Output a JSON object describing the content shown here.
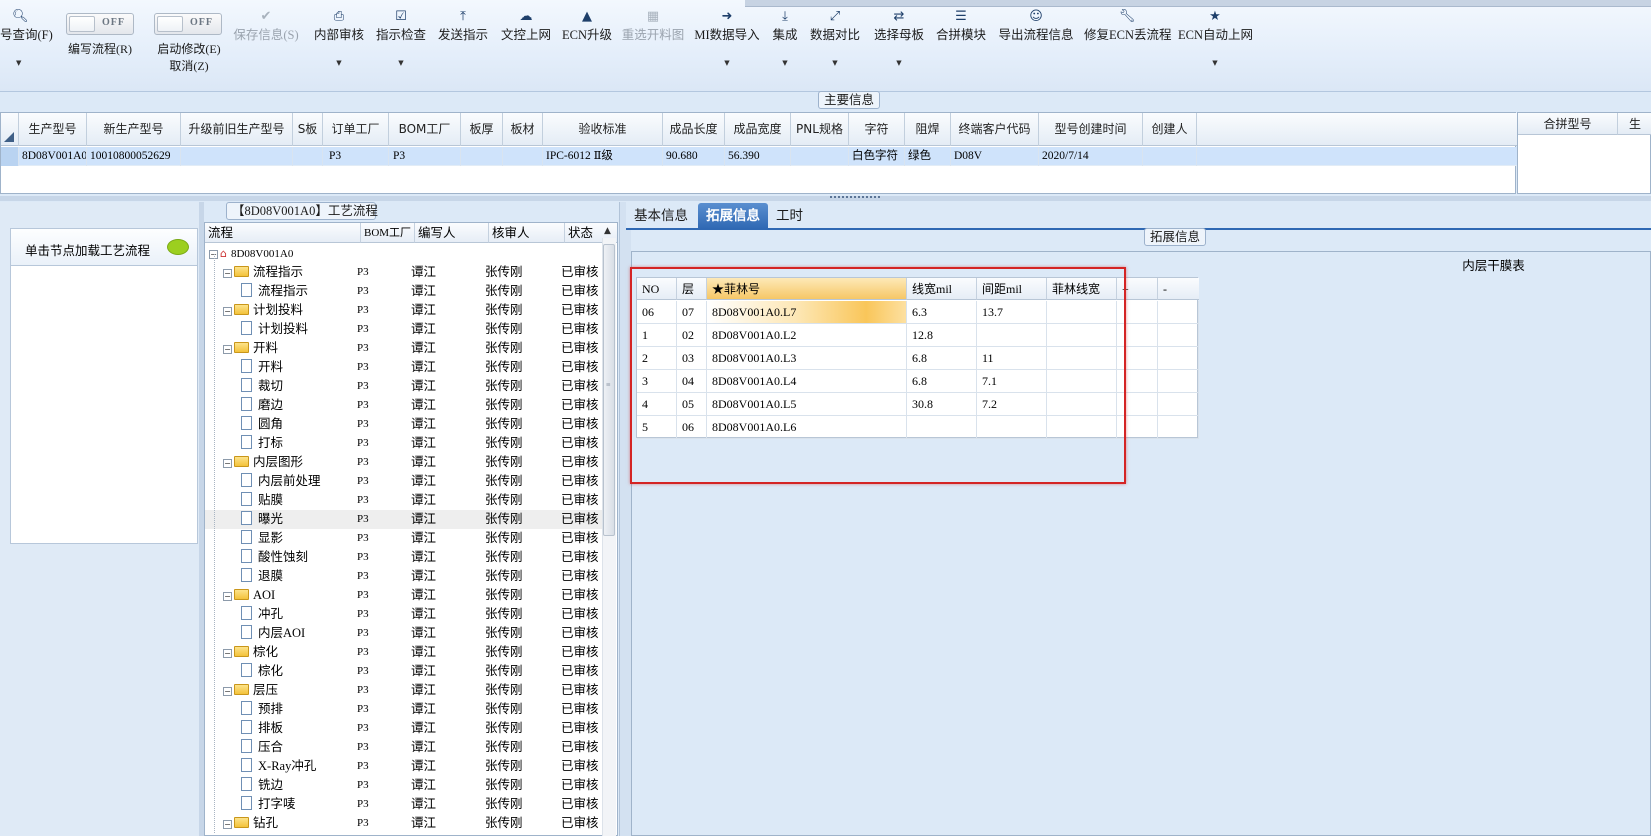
{
  "toolbar": {
    "query_label": "号查询(F)",
    "edit_flow": {
      "toggle": "OFF",
      "label": "编写流程(R)"
    },
    "start_modify": {
      "toggle": "OFF",
      "label": "启动修改(E)",
      "sub_label": "取消(Z)"
    },
    "buttons": [
      {
        "label": "保存信息(S)",
        "icon": "check-icon",
        "disabled": true
      },
      {
        "label": "内部审核",
        "icon": "printer-icon"
      },
      {
        "label": "指示检查",
        "icon": "checkbox-icon"
      },
      {
        "label": "发送指示",
        "icon": "upload-icon"
      },
      {
        "label": "文控上网",
        "icon": "cloud-upload-icon"
      },
      {
        "label": "ECN升级",
        "icon": "ecn-icon"
      },
      {
        "label": "重选开料图",
        "icon": "image-icon",
        "disabled": true
      },
      {
        "label": "MI数据导入",
        "icon": "import-icon"
      },
      {
        "label": "集成",
        "icon": "download-icon"
      },
      {
        "label": "数据对比",
        "icon": "compare-icon"
      },
      {
        "label": "选择母板",
        "icon": "shuffle-icon"
      },
      {
        "label": "合拼模块",
        "icon": "list-icon"
      },
      {
        "label": "导出流程信息",
        "icon": "smile-icon"
      },
      {
        "label": "修复ECN丢流程",
        "icon": "wrench-icon"
      },
      {
        "label": "ECN自动上网",
        "icon": "star-icon"
      }
    ]
  },
  "main_info": {
    "caption": "主要信息",
    "columns": [
      "生产型号",
      "新生产型号",
      "升级前旧生产型号",
      "S板",
      "订单工厂",
      "BOM工厂",
      "板厚",
      "板材",
      "验收标准",
      "成品长度",
      "成品宽度",
      "PNL规格",
      "字符",
      "阻焊",
      "终端客户代码",
      "型号创建时间",
      "创建人"
    ],
    "row": [
      "8D08V001A0",
      "10010800052629",
      "",
      "",
      "P3",
      "P3",
      "",
      "",
      "IPC-6012 Ⅱ级",
      "90.680",
      "56.390",
      "",
      "白色字符",
      "绿色",
      "D08V",
      "2020/7/14",
      ""
    ],
    "right_columns": [
      "合拼型号",
      "生"
    ]
  },
  "left_panel": {
    "load_button": "单击节点加载工艺流程"
  },
  "flow": {
    "caption": "【8D08V001A0】工艺流程",
    "columns": [
      "流程",
      "BOM工厂",
      "编写人",
      "核审人",
      "状态"
    ],
    "rows": [
      {
        "name": "8D08V001A0",
        "level": 0,
        "type": "root",
        "bom": "",
        "writer": "",
        "reviewer": "",
        "status": ""
      },
      {
        "name": "流程指示",
        "level": 1,
        "type": "folder",
        "bom": "P3",
        "writer": "谭江",
        "reviewer": "张传刚",
        "status": "已审核"
      },
      {
        "name": "流程指示",
        "level": 2,
        "type": "doc",
        "bom": "P3",
        "writer": "谭江",
        "reviewer": "张传刚",
        "status": "已审核"
      },
      {
        "name": "计划投料",
        "level": 1,
        "type": "folder",
        "bom": "P3",
        "writer": "谭江",
        "reviewer": "张传刚",
        "status": "已审核"
      },
      {
        "name": "计划投料",
        "level": 2,
        "type": "doc",
        "bom": "P3",
        "writer": "谭江",
        "reviewer": "张传刚",
        "status": "已审核"
      },
      {
        "name": "开料",
        "level": 1,
        "type": "folder",
        "bom": "P3",
        "writer": "谭江",
        "reviewer": "张传刚",
        "status": "已审核"
      },
      {
        "name": "开料",
        "level": 2,
        "type": "doc",
        "bom": "P3",
        "writer": "谭江",
        "reviewer": "张传刚",
        "status": "已审核"
      },
      {
        "name": "裁切",
        "level": 2,
        "type": "doc",
        "bom": "P3",
        "writer": "谭江",
        "reviewer": "张传刚",
        "status": "已审核"
      },
      {
        "name": "磨边",
        "level": 2,
        "type": "doc",
        "bom": "P3",
        "writer": "谭江",
        "reviewer": "张传刚",
        "status": "已审核"
      },
      {
        "name": "圆角",
        "level": 2,
        "type": "doc",
        "bom": "P3",
        "writer": "谭江",
        "reviewer": "张传刚",
        "status": "已审核"
      },
      {
        "name": "打标",
        "level": 2,
        "type": "doc",
        "bom": "P3",
        "writer": "谭江",
        "reviewer": "张传刚",
        "status": "已审核"
      },
      {
        "name": "内层图形",
        "level": 1,
        "type": "folder",
        "bom": "P3",
        "writer": "谭江",
        "reviewer": "张传刚",
        "status": "已审核"
      },
      {
        "name": "内层前处理",
        "level": 2,
        "type": "doc",
        "bom": "P3",
        "writer": "谭江",
        "reviewer": "张传刚",
        "status": "已审核"
      },
      {
        "name": "贴膜",
        "level": 2,
        "type": "doc",
        "bom": "P3",
        "writer": "谭江",
        "reviewer": "张传刚",
        "status": "已审核"
      },
      {
        "name": "曝光",
        "level": 2,
        "type": "doc",
        "bom": "P3",
        "writer": "谭江",
        "reviewer": "张传刚",
        "status": "已审核",
        "selected": true
      },
      {
        "name": "显影",
        "level": 2,
        "type": "doc",
        "bom": "P3",
        "writer": "谭江",
        "reviewer": "张传刚",
        "status": "已审核"
      },
      {
        "name": "酸性蚀刻",
        "level": 2,
        "type": "doc",
        "bom": "P3",
        "writer": "谭江",
        "reviewer": "张传刚",
        "status": "已审核"
      },
      {
        "name": "退膜",
        "level": 2,
        "type": "doc",
        "bom": "P3",
        "writer": "谭江",
        "reviewer": "张传刚",
        "status": "已审核"
      },
      {
        "name": "AOI",
        "level": 1,
        "type": "folder",
        "bom": "P3",
        "writer": "谭江",
        "reviewer": "张传刚",
        "status": "已审核"
      },
      {
        "name": "冲孔",
        "level": 2,
        "type": "doc",
        "bom": "P3",
        "writer": "谭江",
        "reviewer": "张传刚",
        "status": "已审核"
      },
      {
        "name": "内层AOI",
        "level": 2,
        "type": "doc",
        "bom": "P3",
        "writer": "谭江",
        "reviewer": "张传刚",
        "status": "已审核"
      },
      {
        "name": "棕化",
        "level": 1,
        "type": "folder",
        "bom": "P3",
        "writer": "谭江",
        "reviewer": "张传刚",
        "status": "已审核"
      },
      {
        "name": "棕化",
        "level": 2,
        "type": "doc",
        "bom": "P3",
        "writer": "谭江",
        "reviewer": "张传刚",
        "status": "已审核"
      },
      {
        "name": "层压",
        "level": 1,
        "type": "folder",
        "bom": "P3",
        "writer": "谭江",
        "reviewer": "张传刚",
        "status": "已审核"
      },
      {
        "name": "预排",
        "level": 2,
        "type": "doc",
        "bom": "P3",
        "writer": "谭江",
        "reviewer": "张传刚",
        "status": "已审核"
      },
      {
        "name": "排板",
        "level": 2,
        "type": "doc",
        "bom": "P3",
        "writer": "谭江",
        "reviewer": "张传刚",
        "status": "已审核"
      },
      {
        "name": "压合",
        "level": 2,
        "type": "doc",
        "bom": "P3",
        "writer": "谭江",
        "reviewer": "张传刚",
        "status": "已审核"
      },
      {
        "name": "X-Ray冲孔",
        "level": 2,
        "type": "doc",
        "bom": "P3",
        "writer": "谭江",
        "reviewer": "张传刚",
        "status": "已审核"
      },
      {
        "name": "铣边",
        "level": 2,
        "type": "doc",
        "bom": "P3",
        "writer": "谭江",
        "reviewer": "张传刚",
        "status": "已审核"
      },
      {
        "name": "打字唛",
        "level": 2,
        "type": "doc",
        "bom": "P3",
        "writer": "谭江",
        "reviewer": "张传刚",
        "status": "已审核"
      },
      {
        "name": "钻孔",
        "level": 1,
        "type": "folder",
        "bom": "P3",
        "writer": "谭江",
        "reviewer": "张传刚",
        "status": "已审核"
      }
    ]
  },
  "tabs": [
    {
      "label": "基本信息",
      "active": false
    },
    {
      "label": "拓展信息",
      "active": true
    },
    {
      "label": "工时",
      "active": false
    }
  ],
  "extension": {
    "caption": "拓展信息",
    "table_title": "内层干膜表",
    "columns": [
      "NO",
      "层",
      "★菲林号",
      "线宽mil",
      "间距mil",
      "菲林线宽",
      "+",
      "-"
    ],
    "rows": [
      [
        "06",
        "07",
        "8D08V001A0.L7",
        "6.3",
        "13.7",
        "",
        "",
        ""
      ],
      [
        "1",
        "02",
        "8D08V001A0.L2",
        "12.8",
        "",
        "",
        "",
        ""
      ],
      [
        "2",
        "03",
        "8D08V001A0.L3",
        "6.8",
        "11",
        "",
        "",
        ""
      ],
      [
        "3",
        "04",
        "8D08V001A0.L4",
        "6.8",
        "7.1",
        "",
        "",
        ""
      ],
      [
        "4",
        "05",
        "8D08V001A0.L5",
        "30.8",
        "7.2",
        "",
        "",
        ""
      ],
      [
        "5",
        "06",
        "8D08V001A0.L6",
        "",
        "",
        "",
        "",
        ""
      ]
    ]
  },
  "colors": {
    "accent": "#2f68b3",
    "highlight": "#d42424",
    "selected_row": "#cfe3fb"
  }
}
